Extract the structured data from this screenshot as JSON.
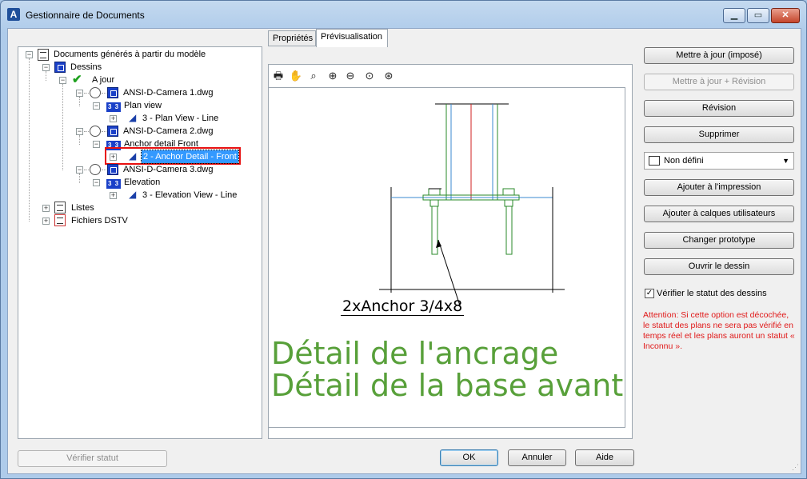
{
  "window": {
    "title": "Gestionnaire de Documents",
    "app_icon": "A"
  },
  "titlebar": {
    "minimize": "▁",
    "maximize": "▭",
    "close": "✕"
  },
  "tree": {
    "root": "Documents générés à partir du modèle",
    "dessins": "Dessins",
    "a_jour": "A jour",
    "cam1": "ANSI-D-Camera 1.dwg",
    "cam1_view": "Plan view",
    "cam1_item": "3 - Plan View - Line",
    "cam2": "ANSI-D-Camera 2.dwg",
    "cam2_view": "Anchor detail Front",
    "cam2_item": "2 - Anchor Detail - Front",
    "cam3": "ANSI-D-Camera 3.dwg",
    "cam3_view": "Elevation",
    "cam3_item": "3 - Elevation View - Line",
    "listes": "Listes",
    "dstv": "Fichiers DSTV",
    "view_icon_text": "3 3"
  },
  "tabs": {
    "props": "Propriétés",
    "preview": "Prévisualisation"
  },
  "preview": {
    "dim_label": "2xAnchor 3/4x8",
    "line1": "Détail de l'ancrage",
    "line2": "Détail de la base avant"
  },
  "buttons": {
    "update_forced": "Mettre à jour (imposé)",
    "update_rev": "Mettre à jour + Révision",
    "revision": "Révision",
    "delete": "Supprimer",
    "add_print": "Ajouter à l'impression",
    "add_layers": "Ajouter à calques utilisateurs",
    "change_proto": "Changer prototype",
    "open_drawing": "Ouvrir le dessin",
    "verify_status": "Vérifier statut",
    "ok": "OK",
    "cancel": "Annuler",
    "help": "Aide"
  },
  "combo": {
    "value": "Non défini"
  },
  "checkbox": {
    "label": "Vérifier le statut des dessins",
    "checked": true
  },
  "warning": "Attention: Si cette option est décochée, le statut des plans ne sera pas vérifié en temps réel et les plans auront un statut « Inconnu ».",
  "colors": {
    "accent": "#3399ff",
    "warning": "#e01818",
    "drawing_text": "#58a03a"
  }
}
